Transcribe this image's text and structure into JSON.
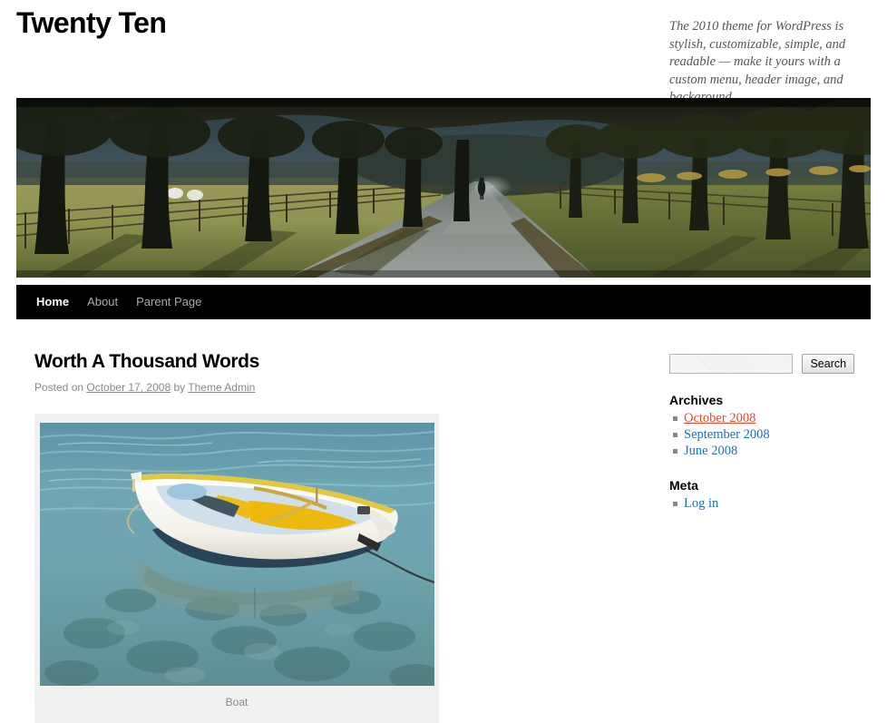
{
  "site": {
    "title": "Twenty Ten",
    "description": "The 2010 theme for WordPress is stylish, customizable, simple, and readable — make it yours with a custom menu, header image, and background.",
    "header_image_alt": "tree-lined-path-header"
  },
  "nav": {
    "items": [
      {
        "label": "Home",
        "current": true
      },
      {
        "label": "About",
        "current": false
      },
      {
        "label": "Parent Page",
        "current": false
      }
    ]
  },
  "post": {
    "title": "Worth A Thousand Words",
    "meta_prefix": "Posted on",
    "date": "October 17, 2008",
    "meta_by": "by",
    "author": "Theme Admin",
    "caption": "Boat",
    "image_alt": "white-rowboat-on-clear-water"
  },
  "sidebar": {
    "search": {
      "value": "",
      "placeholder": "",
      "button_label": "Search"
    },
    "archives": {
      "title": "Archives",
      "items": [
        {
          "label": "October 2008",
          "state": "hovered"
        },
        {
          "label": "September 2008",
          "state": "normal"
        },
        {
          "label": "June 2008",
          "state": "normal"
        }
      ]
    },
    "meta": {
      "title": "Meta",
      "items": [
        {
          "label": "Log in",
          "state": "normal"
        }
      ]
    }
  },
  "colors": {
    "link": "#1e6bc6",
    "link_hover": "#e8472b",
    "nav_bg": "#000000",
    "caption_bg": "#f1f1f1",
    "meta_text": "#888888"
  }
}
